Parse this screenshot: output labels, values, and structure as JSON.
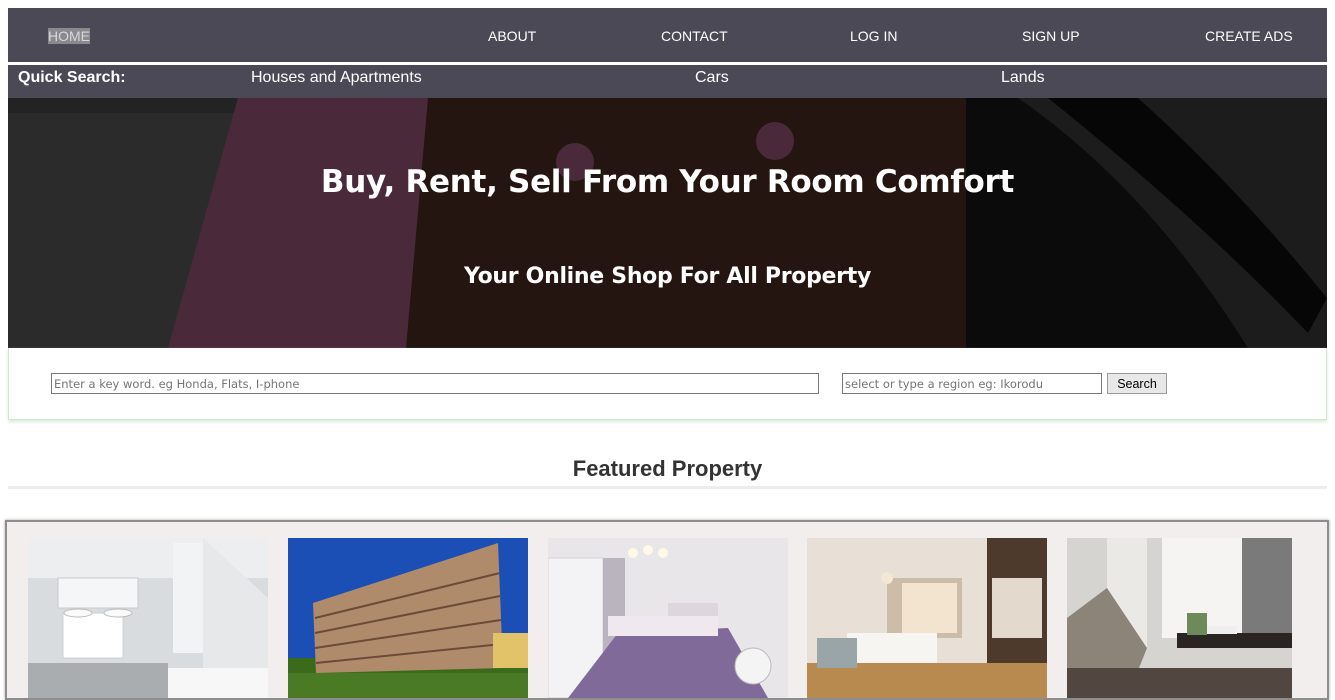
{
  "nav": {
    "home": "HOME",
    "about": "ABOUT",
    "contact": "CONTACT",
    "login": "LOG IN",
    "signup": "SIGN UP",
    "create_ads": "CREATE ADS"
  },
  "quick_search": {
    "label": "Quick Search:",
    "items": [
      "Houses and Apartments",
      "Cars",
      "Lands"
    ]
  },
  "hero": {
    "title": "Buy, Rent, Sell From Your Room Comfort",
    "subtitle": "Your Online Shop For All Property"
  },
  "search": {
    "keyword_placeholder": "Enter a key word. eg Honda, Flats, I-phone",
    "region_placeholder": "select or type a region eg: Ikorodu",
    "button": "Search"
  },
  "featured": {
    "title": "Featured Property",
    "images": [
      "bathroom-photo",
      "apartment-building-photo",
      "bedroom-photo",
      "hotel-room-photo",
      "living-room-photo"
    ]
  }
}
